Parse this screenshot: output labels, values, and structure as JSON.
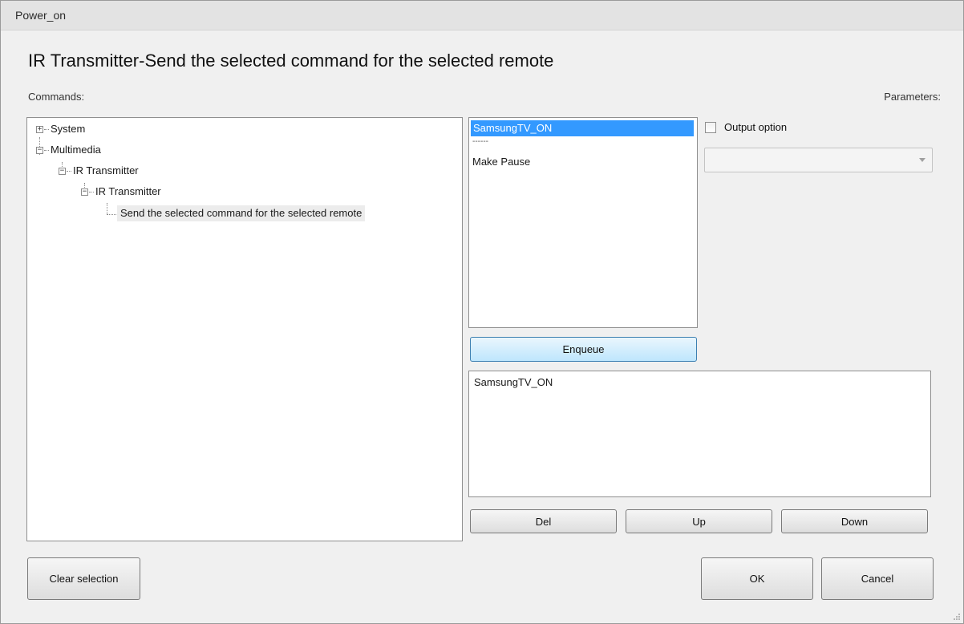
{
  "window": {
    "title": "Power_on"
  },
  "header": {
    "title": "IR Transmitter-Send the selected command for the selected remote"
  },
  "labels": {
    "commands": "Commands:",
    "parameters": "Parameters:"
  },
  "tree": {
    "nodes": [
      {
        "label": "System",
        "expander": "+",
        "selected": false
      },
      {
        "label": "Multimedia",
        "expander": "−",
        "selected": false
      },
      {
        "label": "IR Transmitter",
        "expander": "−",
        "selected": false
      },
      {
        "label": "IR Transmitter",
        "expander": "−",
        "selected": false
      },
      {
        "label": "Send the selected command for the selected remote",
        "expander": "",
        "selected": true
      }
    ]
  },
  "command_list": {
    "items": [
      {
        "label": "SamsungTV_ON",
        "selected": true
      },
      {
        "label": "------",
        "selected": false
      },
      {
        "label": "Make Pause",
        "selected": false
      }
    ]
  },
  "buttons": {
    "enqueue": "Enqueue",
    "del": "Del",
    "up": "Up",
    "down": "Down",
    "clear_selection": "Clear  selection",
    "ok": "OK",
    "cancel": "Cancel"
  },
  "queue": {
    "items": [
      "SamsungTV_ON"
    ]
  },
  "parameters": {
    "output_option_label": "Output option",
    "output_option_checked": false,
    "dropdown_value": "",
    "dropdown_enabled": false
  },
  "colors": {
    "selection": "#3399ff",
    "focus_border": "#3c7fb1"
  },
  "icons": {
    "expand": "plus-box-icon",
    "collapse": "minus-box-icon",
    "dropdown": "chevron-down-icon",
    "resize": "resize-grip-icon"
  }
}
